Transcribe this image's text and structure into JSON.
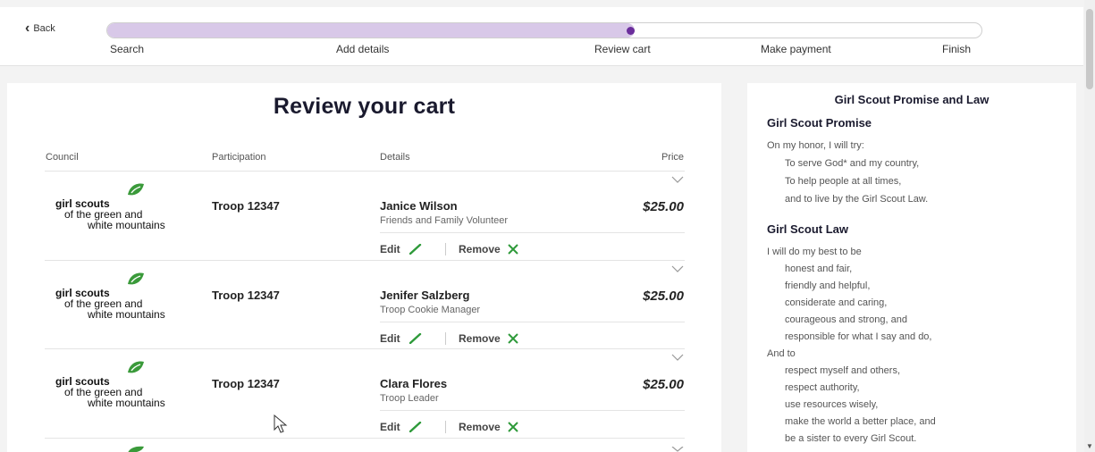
{
  "nav": {
    "back_label": "Back",
    "progress_fraction": 0.603,
    "steps": [
      "Search",
      "Add details",
      "Review cart",
      "Make payment",
      "Finish"
    ]
  },
  "cart": {
    "title": "Review your cart",
    "columns": {
      "council": "Council",
      "participation": "Participation",
      "details": "Details",
      "price": "Price"
    },
    "council_logo": {
      "line1": "girl scouts",
      "line2": "of the green and",
      "line3": "white mountains"
    },
    "items": [
      {
        "troop": "Troop 12347",
        "name": "Janice Wilson",
        "role": "Friends and Family Volunteer",
        "price": "$25.00",
        "edit": "Edit",
        "remove": "Remove"
      },
      {
        "troop": "Troop 12347",
        "name": "Jenifer Salzberg",
        "role": "Troop Cookie Manager",
        "price": "$25.00",
        "edit": "Edit",
        "remove": "Remove"
      },
      {
        "troop": "Troop 12347",
        "name": "Clara Flores",
        "role": "Troop Leader",
        "price": "$25.00",
        "edit": "Edit",
        "remove": "Remove"
      }
    ]
  },
  "sidebar": {
    "title": "Girl Scout Promise and Law",
    "promise_heading": "Girl Scout Promise",
    "promise_lines": [
      "On my honor, I will try:",
      "To serve God* and my country,",
      "To help people at all times,",
      "and to live by the Girl Scout Law."
    ],
    "law_heading": "Girl Scout Law",
    "law_lines": [
      "I will do my best to be",
      "honest and fair,",
      "friendly and helpful,",
      "considerate and caring,",
      "courageous and strong, and",
      "responsible for what I say and do,",
      "And to",
      "respect myself and others,",
      "respect authority,",
      "use resources wisely,",
      "make the world a better place, and",
      "be a sister to every Girl Scout."
    ]
  },
  "colors": {
    "accent_purple": "#6b2e9c",
    "progress_fill": "#d8c8e8",
    "leaf_green": "#3a9a3a",
    "remove_green": "#2e9a3a"
  }
}
